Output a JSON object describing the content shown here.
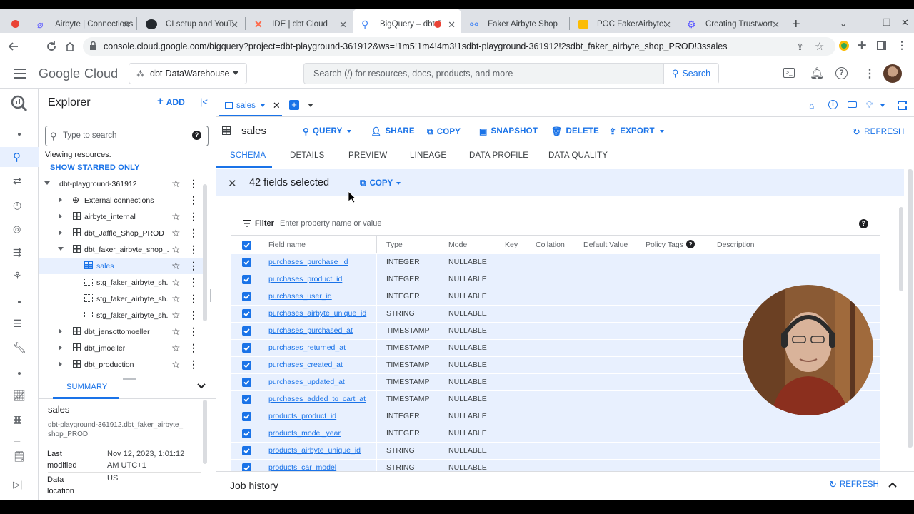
{
  "browser": {
    "tabs": [
      {
        "title": "Airbyte | Connections",
        "icon": "airbyte-icon"
      },
      {
        "title": "CI setup and YouTube",
        "icon": "github-icon"
      },
      {
        "title": "IDE | dbt Cloud",
        "icon": "dbt-icon"
      },
      {
        "title": "BigQuery – dbt-D",
        "icon": "bigquery-icon"
      },
      {
        "title": "Faker Airbyte Shop",
        "icon": "link-icon"
      },
      {
        "title": "POC FakerAirbyteSho",
        "icon": "slides-icon"
      },
      {
        "title": "Creating Trustworthy",
        "icon": "gear-icon"
      }
    ],
    "url": "console.cloud.google.com/bigquery?project=dbt-playground-361912&ws=!1m5!1m4!4m3!1sdbt-playground-361912!2sdbt_faker_airbyte_shop_PROD!3ssales"
  },
  "header": {
    "logo_google": "Google",
    "logo_cloud": "Cloud",
    "project": "dbt-DataWarehouse",
    "search_placeholder": "Search (/) for resources, docs, products, and more",
    "search_button": "Search"
  },
  "explorer": {
    "title": "Explorer",
    "add_label": "ADD",
    "search_placeholder": "Type to search",
    "viewing": "Viewing resources.",
    "show_starred": "SHOW STARRED ONLY",
    "tree": [
      {
        "label": "dbt-playground-361912",
        "level": 0
      },
      {
        "label": "External connections",
        "level": 1
      },
      {
        "label": "airbyte_internal",
        "level": 1
      },
      {
        "label": "dbt_Jaffle_Shop_PROD",
        "level": 1
      },
      {
        "label": "dbt_faker_airbyte_shop_...",
        "level": 1
      },
      {
        "label": "sales",
        "level": 2
      },
      {
        "label": "stg_faker_airbyte_sh...",
        "level": 2
      },
      {
        "label": "stg_faker_airbyte_sh...",
        "level": 2
      },
      {
        "label": "stg_faker_airbyte_sh...",
        "level": 2
      },
      {
        "label": "dbt_jensottomoeller",
        "level": 1
      },
      {
        "label": "dbt_jmoeller",
        "level": 1
      },
      {
        "label": "dbt_production",
        "level": 1
      }
    ],
    "summary_tab": "SUMMARY",
    "summary": {
      "name": "sales",
      "path": "dbt-playground-361912.dbt_faker_airbyte_shop_PROD",
      "last_modified_label": "Last modified",
      "last_modified_value": "Nov 12, 2023, 1:01:12 AM UTC+1",
      "data_location_label": "Data location",
      "data_location_value": "US"
    }
  },
  "main": {
    "tab_label": "sales",
    "table_name": "sales",
    "toolbar": {
      "query": "QUERY",
      "share": "SHARE",
      "copy": "COPY",
      "snapshot": "SNAPSHOT",
      "delete": "DELETE",
      "export": "EXPORT",
      "refresh": "REFRESH"
    },
    "subtabs": [
      "SCHEMA",
      "DETAILS",
      "PREVIEW",
      "LINEAGE",
      "DATA PROFILE",
      "DATA QUALITY"
    ],
    "selection": {
      "count_text": "42 fields selected",
      "copy": "COPY"
    },
    "filter_label": "Filter",
    "filter_placeholder": "Enter property name or value",
    "columns": [
      "Field name",
      "Type",
      "Mode",
      "Key",
      "Collation",
      "Default Value",
      "Policy Tags",
      "Description"
    ],
    "rows": [
      {
        "name": "purchases_purchase_id",
        "type": "INTEGER",
        "mode": "NULLABLE"
      },
      {
        "name": "purchases_product_id",
        "type": "INTEGER",
        "mode": "NULLABLE"
      },
      {
        "name": "purchases_user_id",
        "type": "INTEGER",
        "mode": "NULLABLE"
      },
      {
        "name": "purchases_airbyte_unique_id",
        "type": "STRING",
        "mode": "NULLABLE"
      },
      {
        "name": "purchases_purchased_at",
        "type": "TIMESTAMP",
        "mode": "NULLABLE"
      },
      {
        "name": "purchases_returned_at",
        "type": "TIMESTAMP",
        "mode": "NULLABLE"
      },
      {
        "name": "purchases_created_at",
        "type": "TIMESTAMP",
        "mode": "NULLABLE"
      },
      {
        "name": "purchases_updated_at",
        "type": "TIMESTAMP",
        "mode": "NULLABLE"
      },
      {
        "name": "purchases_added_to_cart_at",
        "type": "TIMESTAMP",
        "mode": "NULLABLE"
      },
      {
        "name": "products_product_id",
        "type": "INTEGER",
        "mode": "NULLABLE"
      },
      {
        "name": "products_model_year",
        "type": "INTEGER",
        "mode": "NULLABLE"
      },
      {
        "name": "products_airbyte_unique_id",
        "type": "STRING",
        "mode": "NULLABLE"
      },
      {
        "name": "products_car_model",
        "type": "STRING",
        "mode": "NULLABLE"
      }
    ],
    "job_history": "Job history",
    "job_refresh": "REFRESH"
  },
  "colors": {
    "accent": "#1a73e8",
    "selection_bg": "#e8f0fe",
    "record_red": "#ea4335"
  }
}
